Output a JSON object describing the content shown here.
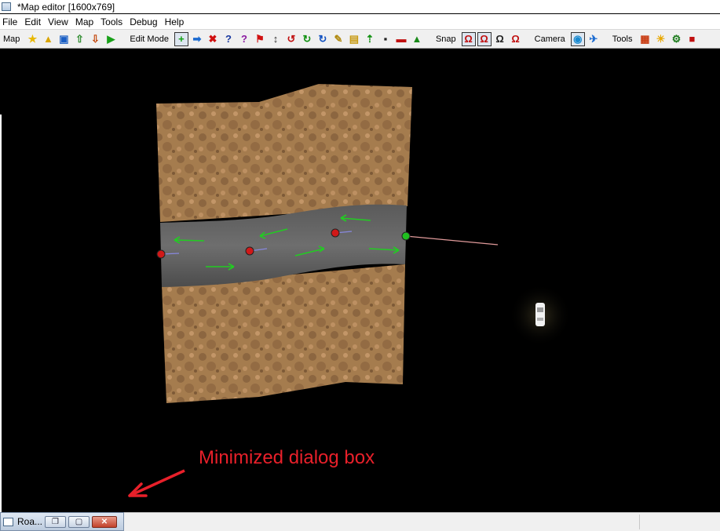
{
  "window": {
    "title": "*Map editor [1600x769]"
  },
  "menu": [
    "File",
    "Edit",
    "View",
    "Map",
    "Tools",
    "Debug",
    "Help"
  ],
  "toolbar": {
    "map_label": "Map",
    "edit_mode_label": "Edit Mode",
    "snap_label": "Snap",
    "camera_label": "Camera",
    "tools_label": "Tools",
    "map_buttons": [
      {
        "name": "favorite-icon",
        "glyph": "★",
        "color": "#e8b800"
      },
      {
        "name": "open-map-icon",
        "glyph": "▲",
        "color": "#d9a400"
      },
      {
        "name": "save-icon",
        "glyph": "▣",
        "color": "#1a5ec4"
      },
      {
        "name": "export-icon",
        "glyph": "⇧",
        "color": "#2a8a2a"
      },
      {
        "name": "import-icon",
        "glyph": "⇩",
        "color": "#c44a10"
      },
      {
        "name": "play-icon",
        "glyph": "▶",
        "color": "#18a018"
      }
    ],
    "edit_buttons": [
      {
        "name": "add-icon",
        "glyph": "+",
        "color": "#10a010",
        "boxed": true
      },
      {
        "name": "move-icon",
        "glyph": "➡",
        "color": "#1a6ad0"
      },
      {
        "name": "delete-icon",
        "glyph": "✖",
        "color": "#d01010"
      },
      {
        "name": "help-icon",
        "glyph": "?",
        "color": "#1a3aa0"
      },
      {
        "name": "question-icon",
        "glyph": "?",
        "color": "#8a1aa0"
      },
      {
        "name": "flag-icon",
        "glyph": "⚑",
        "color": "#d01010"
      },
      {
        "name": "height-icon",
        "glyph": "↕",
        "color": "#333333"
      },
      {
        "name": "rotate-x-icon",
        "glyph": "↺",
        "color": "#c01010"
      },
      {
        "name": "rotate-y-icon",
        "glyph": "↻",
        "color": "#109010"
      },
      {
        "name": "rotate-z-icon",
        "glyph": "↻",
        "color": "#1050c0"
      },
      {
        "name": "brush-icon",
        "glyph": "✎",
        "color": "#b08a10"
      },
      {
        "name": "ruler-icon",
        "glyph": "▤",
        "color": "#c89a10"
      },
      {
        "name": "raise-icon",
        "glyph": "⇡",
        "color": "#109010"
      },
      {
        "name": "camera-path-icon",
        "glyph": "▪",
        "color": "#222222"
      },
      {
        "name": "car-icon",
        "glyph": "▬",
        "color": "#c01010"
      },
      {
        "name": "terrain-icon",
        "glyph": "▲",
        "color": "#1a8a1a"
      }
    ],
    "snap_buttons": [
      {
        "name": "snap-magnet-icon",
        "glyph": "Ω",
        "color": "#c01010",
        "boxed": true
      },
      {
        "name": "snap-magnet-plus-icon",
        "glyph": "Ω",
        "color": "#c01010",
        "boxed": true
      },
      {
        "name": "snap-magnet-grid-icon",
        "glyph": "Ω",
        "color": "#222222"
      },
      {
        "name": "snap-magnet-off-icon",
        "glyph": "Ω",
        "color": "#c01010"
      }
    ],
    "camera_buttons": [
      {
        "name": "globe-icon",
        "glyph": "◉",
        "color": "#1a8ad0",
        "boxed": true
      },
      {
        "name": "bird-icon",
        "glyph": "✈",
        "color": "#1a6ad0"
      }
    ],
    "tools_buttons": [
      {
        "name": "palette-icon",
        "glyph": "▦",
        "color": "#c83a10"
      },
      {
        "name": "sun-icon",
        "glyph": "☀",
        "color": "#e8a800"
      },
      {
        "name": "gear-icon",
        "glyph": "⚙",
        "color": "#1a7a1a"
      },
      {
        "name": "tool-cube-icon",
        "glyph": "■",
        "color": "#c01010"
      }
    ]
  },
  "annotation": {
    "text": "Minimized dialog box",
    "color": "#e8202a"
  },
  "minimized_dialog": {
    "title": "Roa..."
  },
  "colors": {
    "road_marker": "#d01818",
    "road_endpoint": "#20c020",
    "arrow": "#22cc22"
  }
}
